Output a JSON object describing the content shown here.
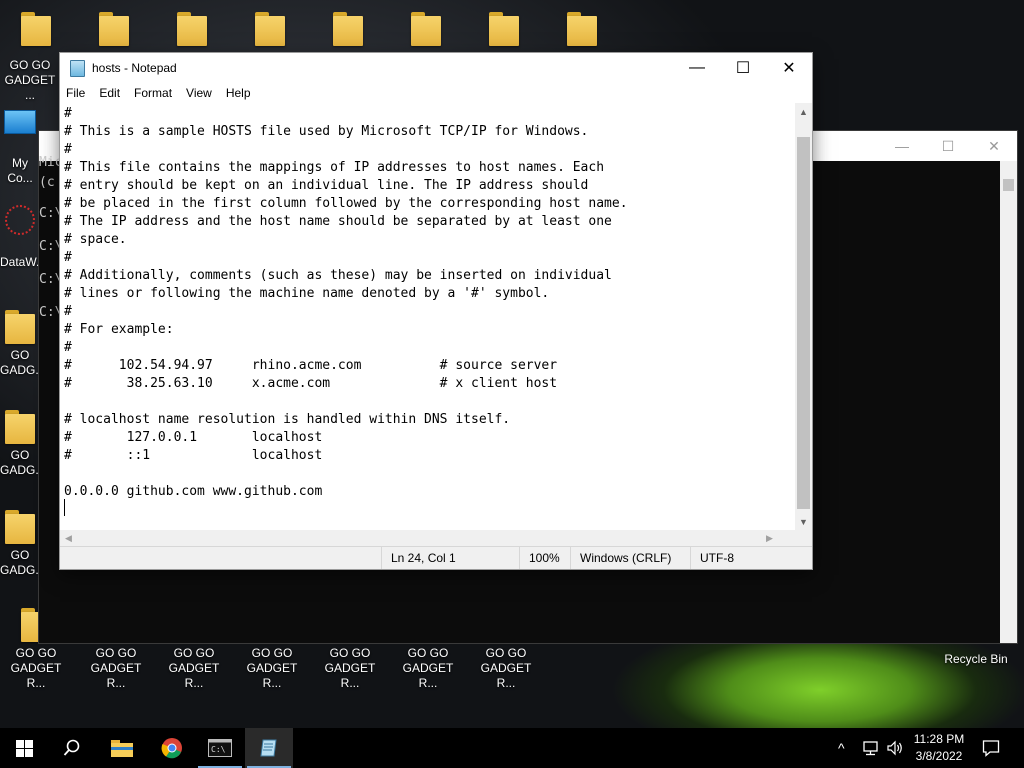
{
  "desktop": {
    "top_icons": [
      "",
      "",
      "",
      "",
      "",
      "",
      "",
      ""
    ],
    "left_icons": [
      {
        "label": "GO GO GADGET ...",
        "type": "folder"
      },
      {
        "label": "My Co...",
        "type": "computer"
      },
      {
        "label": "DataW...",
        "type": "app"
      },
      {
        "label": "GO GADG...",
        "type": "folder"
      },
      {
        "label": "GO GADG...",
        "type": "folder"
      },
      {
        "label": "GO GADG...",
        "type": "folder"
      }
    ],
    "bottom_icons": [
      "GO GO GADGET R...",
      "GO GO GADGET R...",
      "GO GO GADGET R...",
      "GO GO GADGET R...",
      "GO GO GADGET R...",
      "GO GO GADGET R...",
      "GO GO GADGET R..."
    ],
    "recycle_bin": "Recycle Bin"
  },
  "cmd": {
    "lines": [
      "Mic",
      "(c",
      "C:\\",
      "C:\\",
      "C:\\",
      "C:\\"
    ],
    "minimize": "—",
    "maximize": "☐",
    "close": "✕"
  },
  "notepad": {
    "title": "hosts - Notepad",
    "minimize": "—",
    "maximize": "☐",
    "close": "✕",
    "menu": [
      "File",
      "Edit",
      "Format",
      "View",
      "Help"
    ],
    "content": "#\n# This is a sample HOSTS file used by Microsoft TCP/IP for Windows.\n#\n# This file contains the mappings of IP addresses to host names. Each\n# entry should be kept on an individual line. The IP address should\n# be placed in the first column followed by the corresponding host name.\n# The IP address and the host name should be separated by at least one\n# space.\n#\n# Additionally, comments (such as these) may be inserted on individual\n# lines or following the machine name denoted by a '#' symbol.\n#\n# For example:\n#\n#      102.54.94.97     rhino.acme.com          # source server\n#       38.25.63.10     x.acme.com              # x client host\n\n# localhost name resolution is handled within DNS itself.\n#       127.0.0.1       localhost\n#       ::1             localhost\n\n0.0.0.0 github.com www.github.com\n",
    "status": {
      "position": "Ln 24, Col 1",
      "zoom": "100%",
      "line_ending": "Windows (CRLF)",
      "encoding": "UTF-8"
    }
  },
  "taskbar": {
    "time": "11:28 PM",
    "date": "3/8/2022",
    "tray_chevron": "^"
  }
}
